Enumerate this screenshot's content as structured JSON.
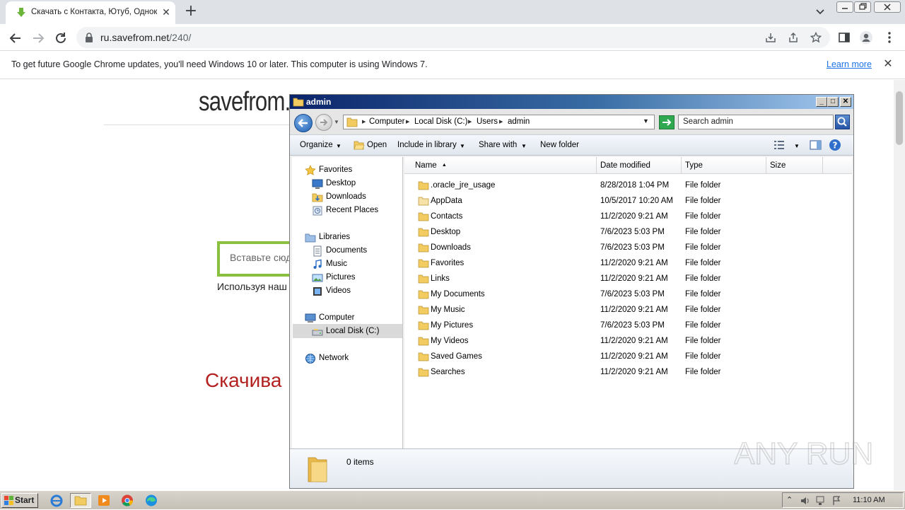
{
  "browser": {
    "tab_title": "Скачать с Контакта, Ютуб, Одноклассников",
    "tab_close": "✕",
    "new_tab": "+",
    "url_host": "ru.savefrom.net",
    "url_path": "/240/",
    "infobar_message": "To get future Google Chrome updates, you'll need Windows 10 or later. This computer is using Windows 7.",
    "infobar_link": "Learn more",
    "infobar_close": "✕"
  },
  "page": {
    "logo": "savefrom.",
    "search_placeholder": "Вставьте сюда",
    "hint": "Используя наш",
    "headline": "Скачива"
  },
  "explorer": {
    "title": "admin",
    "caption_buttons": {
      "minimize": "_",
      "maximize": "□",
      "close": "✕"
    },
    "breadcrumb": [
      "Computer",
      "Local Disk (C:)",
      "Users",
      "admin"
    ],
    "search_placeholder": "Search admin",
    "commands": {
      "organize": "Organize",
      "open": "Open",
      "include_in_library": "Include in library",
      "share_with": "Share with",
      "new_folder": "New folder"
    },
    "nav_pane": {
      "favorites": "Favorites",
      "desktop": "Desktop",
      "downloads": "Downloads",
      "recent_places": "Recent Places",
      "libraries": "Libraries",
      "documents": "Documents",
      "music": "Music",
      "pictures": "Pictures",
      "videos": "Videos",
      "computer": "Computer",
      "local_disk": "Local Disk (C:)",
      "network": "Network"
    },
    "columns": {
      "name": "Name",
      "date_modified": "Date modified",
      "type": "Type",
      "size": "Size"
    },
    "files": [
      {
        "name": ".oracle_jre_usage",
        "date": "8/28/2018 1:04 PM",
        "type": "File folder"
      },
      {
        "name": "AppData",
        "date": "10/5/2017 10:20 AM",
        "type": "File folder"
      },
      {
        "name": "Contacts",
        "date": "11/2/2020 9:21 AM",
        "type": "File folder"
      },
      {
        "name": "Desktop",
        "date": "7/6/2023 5:03 PM",
        "type": "File folder"
      },
      {
        "name": "Downloads",
        "date": "7/6/2023 5:03 PM",
        "type": "File folder"
      },
      {
        "name": "Favorites",
        "date": "11/2/2020 9:21 AM",
        "type": "File folder"
      },
      {
        "name": "Links",
        "date": "11/2/2020 9:21 AM",
        "type": "File folder"
      },
      {
        "name": "My Documents",
        "date": "7/6/2023 5:03 PM",
        "type": "File folder"
      },
      {
        "name": "My Music",
        "date": "11/2/2020 9:21 AM",
        "type": "File folder"
      },
      {
        "name": "My Pictures",
        "date": "7/6/2023 5:03 PM",
        "type": "File folder"
      },
      {
        "name": "My Videos",
        "date": "11/2/2020 9:21 AM",
        "type": "File folder"
      },
      {
        "name": "Saved Games",
        "date": "11/2/2020 9:21 AM",
        "type": "File folder"
      },
      {
        "name": "Searches",
        "date": "11/2/2020 9:21 AM",
        "type": "File folder"
      }
    ],
    "details": "0 items"
  },
  "taskbar": {
    "start_label": "Start",
    "clock": "11:10 AM"
  },
  "watermark": "ANY RUN",
  "colors": {
    "accent_green": "#89c13f",
    "headline_red": "#b32020",
    "link_blue": "#1a73e8"
  }
}
